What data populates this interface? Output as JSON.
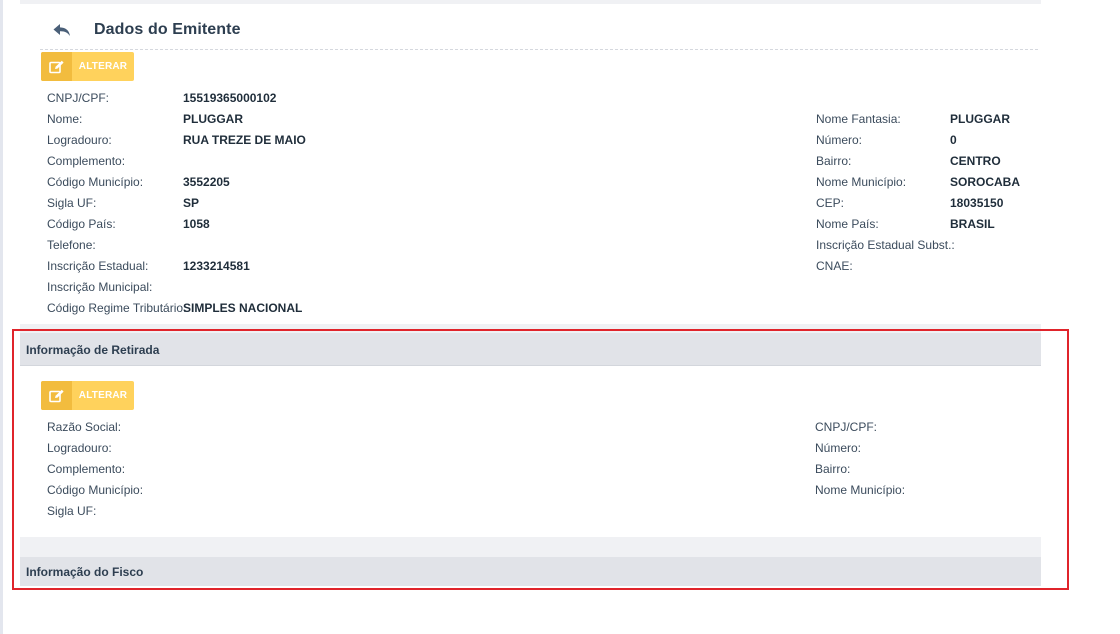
{
  "header": {
    "title": "Dados do Emitente"
  },
  "emitente": {
    "alterar_label": "ALTERAR",
    "left": [
      {
        "label": "CNPJ/CPF:",
        "value": "15519365000102"
      },
      {
        "label": "Nome:",
        "value": "PLUGGAR"
      },
      {
        "label": "Logradouro:",
        "value": "RUA TREZE DE MAIO"
      },
      {
        "label": "Complemento:",
        "value": ""
      },
      {
        "label": "Código Município:",
        "value": "3552205"
      },
      {
        "label": "Sigla UF:",
        "value": "SP"
      },
      {
        "label": "Código País:",
        "value": "1058"
      },
      {
        "label": "Telefone:",
        "value": ""
      },
      {
        "label": "Inscrição Estadual:",
        "value": "1233214581"
      },
      {
        "label": "Inscrição Municipal:",
        "value": ""
      },
      {
        "label": "Código Regime Tributário:",
        "value": "SIMPLES NACIONAL"
      }
    ],
    "right": [
      {
        "label": "Nome Fantasia:",
        "value": "PLUGGAR"
      },
      {
        "label": "Número:",
        "value": "0"
      },
      {
        "label": "Bairro:",
        "value": "CENTRO"
      },
      {
        "label": "Nome Município:",
        "value": "SOROCABA"
      },
      {
        "label": "CEP:",
        "value": "18035150"
      },
      {
        "label": "Nome País:",
        "value": "BRASIL"
      },
      {
        "label": "Inscrição Estadual Subst.:",
        "value": ""
      },
      {
        "label": "CNAE:",
        "value": ""
      }
    ]
  },
  "retirada": {
    "title": "Informação de Retirada",
    "alterar_label": "ALTERAR",
    "left": [
      {
        "label": "Razão Social:"
      },
      {
        "label": "Logradouro:"
      },
      {
        "label": "Complemento:"
      },
      {
        "label": "Código Município:"
      },
      {
        "label": "Sigla UF:"
      }
    ],
    "right": [
      {
        "label": "CNPJ/CPF:"
      },
      {
        "label": "Número:"
      },
      {
        "label": "Bairro:"
      },
      {
        "label": "Nome Município:"
      }
    ]
  },
  "fisco": {
    "title": "Informação do Fisco"
  },
  "colors": {
    "accent_button": "#ffd25c",
    "accent_button_icon": "#f2bc3e",
    "highlight": "#e0242b",
    "section_band": "#e1e3e8"
  }
}
